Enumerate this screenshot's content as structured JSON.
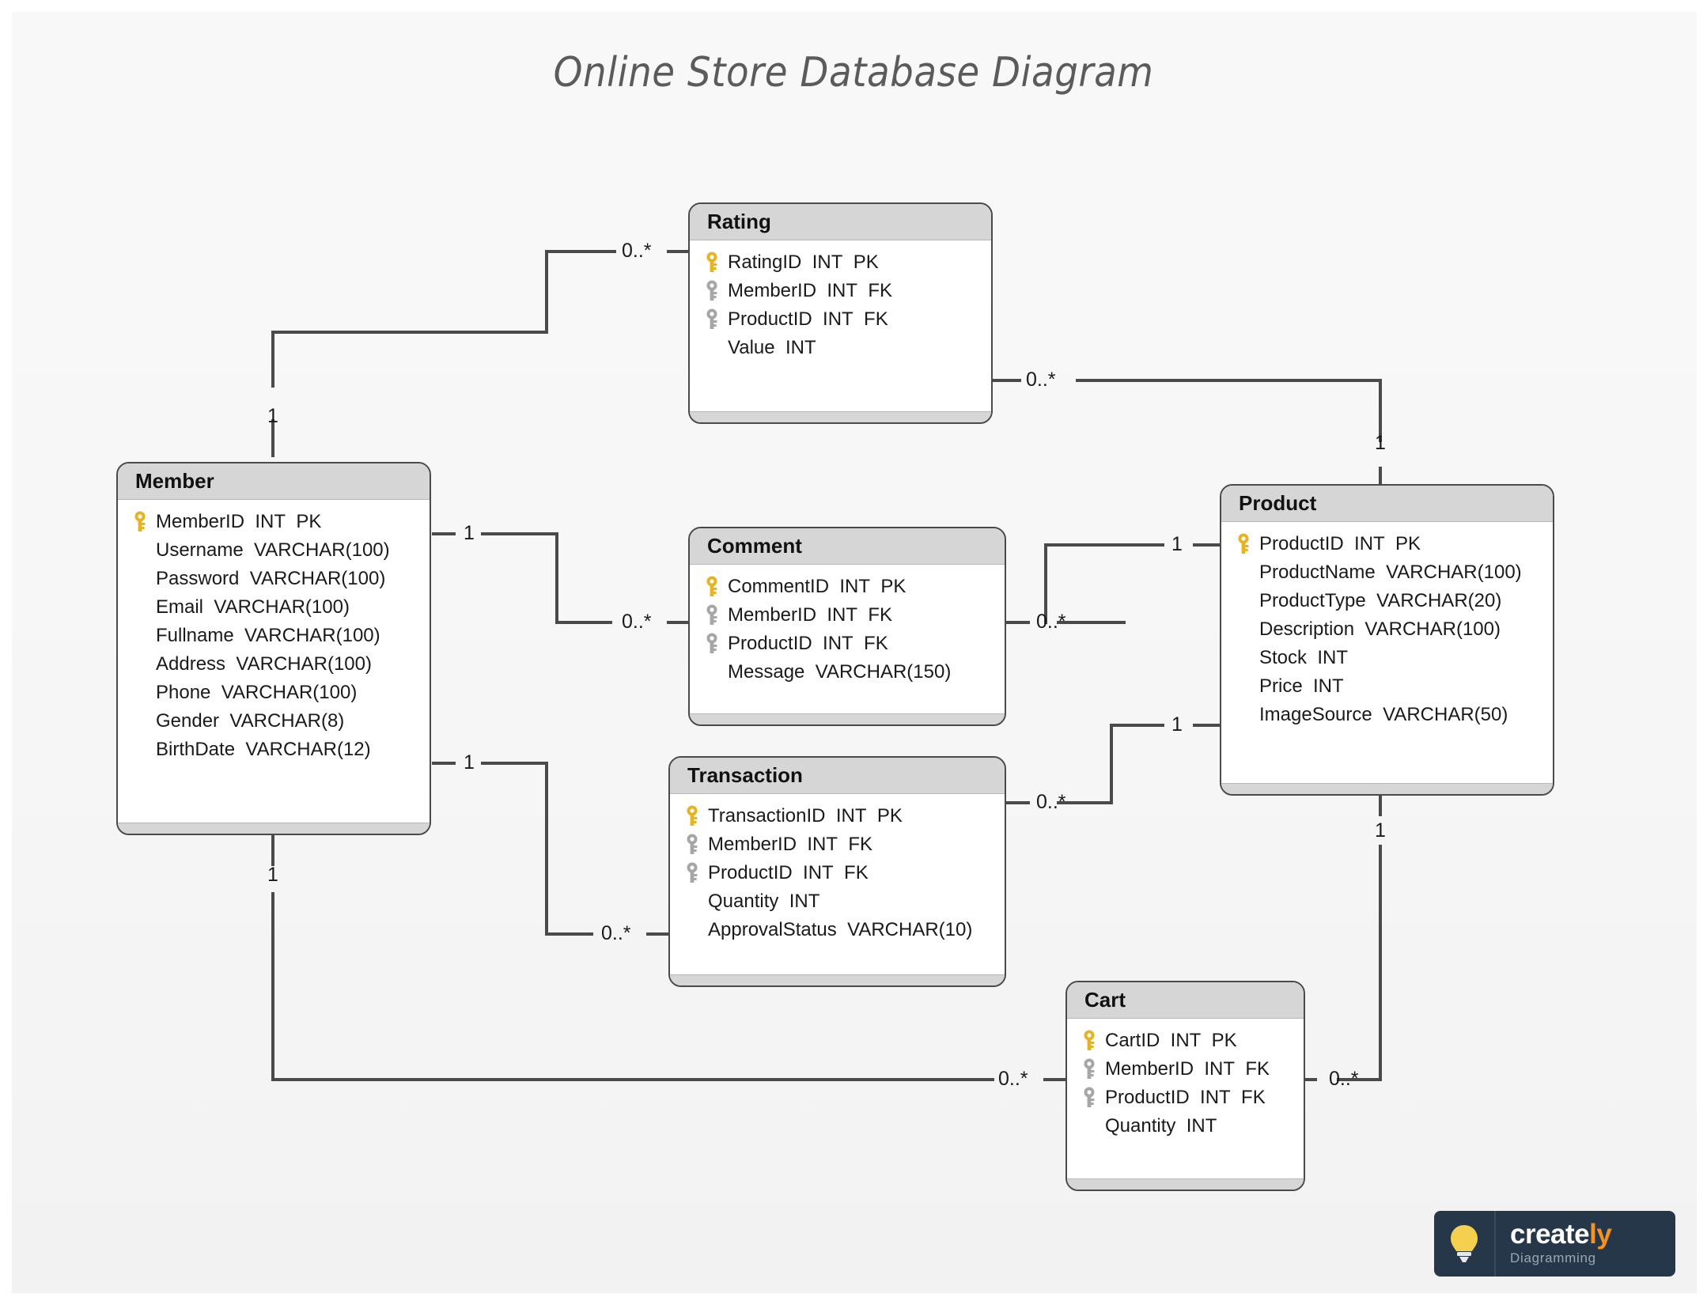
{
  "title": "Online Store Database Diagram",
  "colors": {
    "canvas_bg": "#f7f7f7",
    "entity_header_bg": "#d6d6d6",
    "entity_border": "#4a4a4a",
    "connector": "#4a4a4a",
    "pk_key": "#e8b31f",
    "fk_key": "#a6a6a6",
    "title_text": "#5b5b5b",
    "logo_bg": "#27374a",
    "logo_accent": "#f6921e",
    "logo_bulb": "#f5d04e"
  },
  "entities": {
    "rating": {
      "name": "Rating",
      "attributes": [
        {
          "key": "pk",
          "name": "RatingID",
          "type": "INT",
          "constraint": "PK"
        },
        {
          "key": "fk",
          "name": "MemberID",
          "type": "INT",
          "constraint": "FK"
        },
        {
          "key": "fk",
          "name": "ProductID",
          "type": "INT",
          "constraint": "FK"
        },
        {
          "key": "none",
          "name": "Value",
          "type": "INT",
          "constraint": ""
        }
      ]
    },
    "member": {
      "name": "Member",
      "attributes": [
        {
          "key": "pk",
          "name": "MemberID",
          "type": "INT",
          "constraint": "PK"
        },
        {
          "key": "none",
          "name": "Username",
          "type": "VARCHAR(100)",
          "constraint": ""
        },
        {
          "key": "none",
          "name": "Password",
          "type": "VARCHAR(100)",
          "constraint": ""
        },
        {
          "key": "none",
          "name": "Email",
          "type": "VARCHAR(100)",
          "constraint": ""
        },
        {
          "key": "none",
          "name": "Fullname",
          "type": "VARCHAR(100)",
          "constraint": ""
        },
        {
          "key": "none",
          "name": "Address",
          "type": "VARCHAR(100)",
          "constraint": ""
        },
        {
          "key": "none",
          "name": "Phone",
          "type": "VARCHAR(100)",
          "constraint": ""
        },
        {
          "key": "none",
          "name": "Gender",
          "type": "VARCHAR(8)",
          "constraint": ""
        },
        {
          "key": "none",
          "name": "BirthDate",
          "type": "VARCHAR(12)",
          "constraint": ""
        }
      ]
    },
    "comment": {
      "name": "Comment",
      "attributes": [
        {
          "key": "pk",
          "name": "CommentID",
          "type": "INT",
          "constraint": "PK"
        },
        {
          "key": "fk",
          "name": "MemberID",
          "type": "INT",
          "constraint": "FK"
        },
        {
          "key": "fk",
          "name": "ProductID",
          "type": "INT",
          "constraint": "FK"
        },
        {
          "key": "none",
          "name": "Message",
          "type": "VARCHAR(150)",
          "constraint": ""
        }
      ]
    },
    "transaction": {
      "name": "Transaction",
      "attributes": [
        {
          "key": "pk",
          "name": "TransactionID",
          "type": "INT",
          "constraint": "PK"
        },
        {
          "key": "fk",
          "name": "MemberID",
          "type": "INT",
          "constraint": "FK"
        },
        {
          "key": "fk",
          "name": "ProductID",
          "type": "INT",
          "constraint": "FK"
        },
        {
          "key": "none",
          "name": "Quantity",
          "type": "INT",
          "constraint": ""
        },
        {
          "key": "none",
          "name": "ApprovalStatus",
          "type": "VARCHAR(10)",
          "constraint": ""
        }
      ]
    },
    "product": {
      "name": "Product",
      "attributes": [
        {
          "key": "pk",
          "name": "ProductID",
          "type": "INT",
          "constraint": "PK"
        },
        {
          "key": "none",
          "name": "ProductName",
          "type": "VARCHAR(100)",
          "constraint": ""
        },
        {
          "key": "none",
          "name": "ProductType",
          "type": "VARCHAR(20)",
          "constraint": ""
        },
        {
          "key": "none",
          "name": "Description",
          "type": "VARCHAR(100)",
          "constraint": ""
        },
        {
          "key": "none",
          "name": "Stock",
          "type": "INT",
          "constraint": ""
        },
        {
          "key": "none",
          "name": "Price",
          "type": "INT",
          "constraint": ""
        },
        {
          "key": "none",
          "name": "ImageSource",
          "type": "VARCHAR(50)",
          "constraint": ""
        }
      ]
    },
    "cart": {
      "name": "Cart",
      "attributes": [
        {
          "key": "pk",
          "name": "CartID",
          "type": "INT",
          "constraint": "PK"
        },
        {
          "key": "fk",
          "name": "MemberID",
          "type": "INT",
          "constraint": "FK"
        },
        {
          "key": "fk",
          "name": "ProductID",
          "type": "INT",
          "constraint": "FK"
        },
        {
          "key": "none",
          "name": "Quantity",
          "type": "INT",
          "constraint": ""
        }
      ]
    }
  },
  "relationships": [
    {
      "from": "Member",
      "to": "Rating",
      "from_card": "1",
      "to_card": "0..*"
    },
    {
      "from": "Product",
      "to": "Rating",
      "from_card": "1",
      "to_card": "0..*"
    },
    {
      "from": "Member",
      "to": "Comment",
      "from_card": "1",
      "to_card": "0..*"
    },
    {
      "from": "Product",
      "to": "Comment",
      "from_card": "1",
      "to_card": "0..*"
    },
    {
      "from": "Member",
      "to": "Transaction",
      "from_card": "1",
      "to_card": "0..*"
    },
    {
      "from": "Product",
      "to": "Transaction",
      "from_card": "1",
      "to_card": "0..*"
    },
    {
      "from": "Member",
      "to": "Cart",
      "from_card": "1",
      "to_card": "0..*"
    },
    {
      "from": "Product",
      "to": "Cart",
      "from_card": "1",
      "to_card": "0..*"
    }
  ],
  "cardinality_labels": {
    "member_rating_one": "1",
    "rating_member_many": "0..*",
    "rating_product_many": "0..*",
    "product_rating_one": "1",
    "member_comment_one": "1",
    "comment_member_many": "0..*",
    "comment_product_many": "0..*",
    "product_comment_one": "1",
    "member_transaction_one": "1",
    "transaction_member_many": "0..*",
    "transaction_product_many": "0..*",
    "product_transaction_one": "1",
    "member_cart_one": "1",
    "cart_member_many": "0..*",
    "cart_product_many": "0..*",
    "product_cart_one": "1"
  },
  "logo": {
    "word1": "create",
    "word2": "ly",
    "subtitle": "Diagramming"
  }
}
